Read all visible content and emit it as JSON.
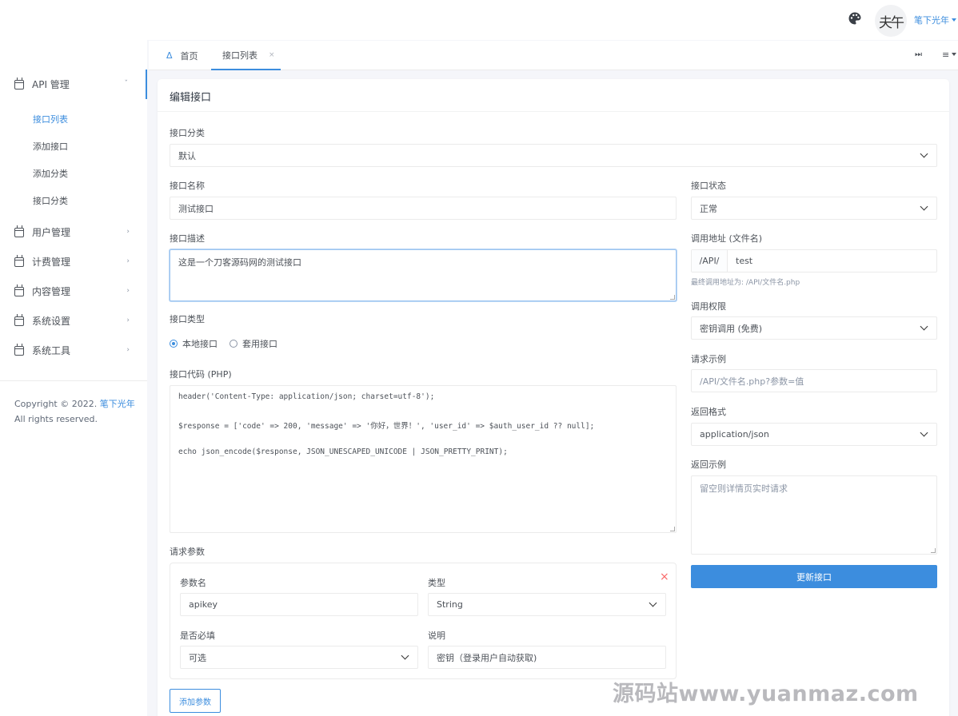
{
  "header": {
    "palette_icon": "palette-icon",
    "avatar_text": "夫午",
    "username": "笔下光年"
  },
  "sidebar": {
    "groups": [
      {
        "label": "API 管理",
        "chevron": "ˇ"
      },
      {
        "label": "用户管理",
        "chevron": "›"
      },
      {
        "label": "计费管理",
        "chevron": "›"
      },
      {
        "label": "内容管理",
        "chevron": "›"
      },
      {
        "label": "系统设置",
        "chevron": "›"
      },
      {
        "label": "系统工具",
        "chevron": "›"
      }
    ],
    "api_links": [
      "接口列表",
      "添加接口",
      "添加分类",
      "接口分类"
    ],
    "copyright_prefix": "Copyright © 2022. ",
    "copyright_link": "笔下光年",
    "copyright_suffix": " All rights reserved."
  },
  "tabs": {
    "home_icon": "Δ",
    "home_label": "首页",
    "api_list_label": "接口列表",
    "close": "×",
    "right_icon1": "⏭",
    "right_icon2": "≡"
  },
  "form": {
    "title": "编辑接口",
    "category_label": "接口分类",
    "category_value": "默认",
    "name_label": "接口名称",
    "name_value": "测试接口",
    "desc_label": "接口描述",
    "desc_value": "这是一个刀客源码网的测试接口",
    "type_label": "接口类型",
    "type_options": [
      "本地接口",
      "套用接口"
    ],
    "type_selected": "本地接口",
    "code_label": "接口代码 (PHP)",
    "code_lines": [
      "header('Content-Type: application/json; charset=utf-8');",
      "$response = ['code' => 200, 'message' => '你好，世界！', 'user_id' => $auth_user_id ?? null];",
      "echo json_encode($response, JSON_UNESCAPED_UNICODE | JSON_PRETTY_PRINT);"
    ],
    "params_label": "请求参数",
    "param": {
      "name_label": "参数名",
      "name_value": "apikey",
      "type_label": "类型",
      "type_value": "String",
      "required_label": "是否必填",
      "required_value": "可选",
      "note_label": "说明",
      "note_value": "密钥（登录用户自动获取)",
      "remove": "×"
    },
    "add_param_button": "添加参数",
    "status_label": "接口状态",
    "status_value": "正常",
    "url_label": "调用地址 (文件名)",
    "url_prefix": "/API/",
    "url_value": "test",
    "url_hint": "最终调用地址为: /API/文件名.php",
    "permission_label": "调用权限",
    "permission_value": "密钥调用 (免费)",
    "example_label": "请求示例",
    "example_placeholder": "/API/文件名.php?参数=值",
    "format_label": "返回格式",
    "format_value": "application/json",
    "return_label": "返回示例",
    "return_placeholder": "留空则详情页实时请求",
    "update_button": "更新接口"
  },
  "watermark": "源码站www.yuanmaz.com"
}
